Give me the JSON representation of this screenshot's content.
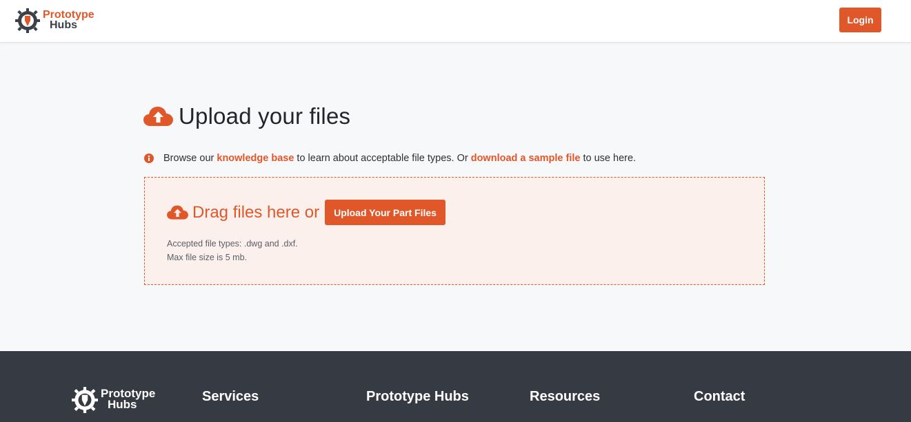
{
  "header": {
    "logo_line1": "Prototype",
    "logo_line2": "Hubs",
    "login_label": "Login"
  },
  "upload": {
    "title": "Upload your files",
    "info_prefix": "Browse our ",
    "kb_link": "knowledge base",
    "info_middle": " to learn about acceptable file types. Or ",
    "sample_link": "download a sample file",
    "info_suffix": " to use here.",
    "drag_text": "Drag files here or",
    "button_label": "Upload Your Part Files",
    "accepted_types": "Accepted file types: .dwg and .dxf.",
    "max_size": "Max file size is 5 mb."
  },
  "footer": {
    "logo_line1": "Prototype",
    "logo_line2": "Hubs",
    "columns": [
      "Services",
      "Prototype Hubs",
      "Resources",
      "Contact"
    ]
  },
  "colors": {
    "accent": "#e0572a",
    "footer_bg": "#363a42",
    "dropzone_bg": "#fcf0ec"
  },
  "icons": [
    "gear-logo-icon",
    "cloud-upload-icon",
    "info-icon"
  ]
}
